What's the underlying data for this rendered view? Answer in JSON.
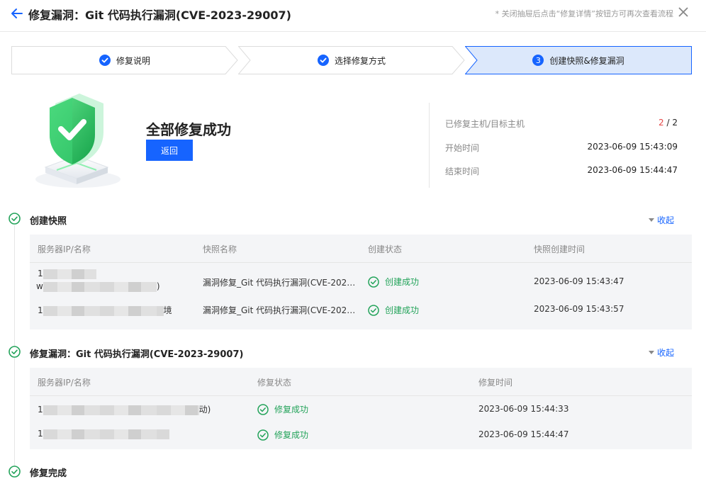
{
  "header": {
    "title": "修复漏洞：Git 代码执行漏洞(CVE-2023-29007)",
    "hint": "* 关闭抽屉后点击“修复详情”按钮方可再次查看流程"
  },
  "steps": [
    {
      "label": "修复说明",
      "status": "done"
    },
    {
      "label": "选择修复方式",
      "status": "done"
    },
    {
      "number": "3",
      "label": "创建快照&修复漏洞",
      "status": "active"
    }
  ],
  "result": {
    "title": "全部修复成功",
    "back_label": "返回",
    "stats": [
      {
        "label": "已修复主机/目标主机",
        "fixed": "2",
        "separator": " / ",
        "total": "2"
      },
      {
        "label": "开始时间",
        "value": "2023-06-09 15:43:09"
      },
      {
        "label": "结束时间",
        "value": "2023-06-09 15:44:47"
      }
    ]
  },
  "snapshot_section": {
    "title": "创建快照",
    "collapse_label": "收起",
    "columns": [
      "服务器IP/名称",
      "快照名称",
      "创建状态",
      "快照创建时间"
    ],
    "rows": [
      {
        "server_line1": "1",
        "server_line2": "w",
        "server_suffix": ")",
        "snapshot": "漏洞修复_Git 代码执行漏洞(CVE-202…",
        "status": "创建成功",
        "time": "2023-06-09 15:43:47"
      },
      {
        "server_line1": "1",
        "server_suffix": "境",
        "snapshot": "漏洞修复_Git 代码执行漏洞(CVE-202…",
        "status": "创建成功",
        "time": "2023-06-09 15:43:57"
      }
    ]
  },
  "fix_section": {
    "title": "修复漏洞：Git 代码执行漏洞(CVE-2023-29007)",
    "collapse_label": "收起",
    "columns": [
      "服务器IP/名称",
      "修复状态",
      "修复时间"
    ],
    "rows": [
      {
        "server_line1": "1",
        "server_suffix": "动)",
        "status": "修复成功",
        "time": "2023-06-09 15:44:33"
      },
      {
        "server_line1": "1",
        "server_suffix": "",
        "status": "修复成功",
        "time": "2023-06-09 15:44:47"
      }
    ]
  },
  "done_section": {
    "title": "修复完成"
  },
  "colors": {
    "accent": "#1664ff",
    "success": "#23a35a",
    "active_step_bg": "#dce8fb"
  }
}
